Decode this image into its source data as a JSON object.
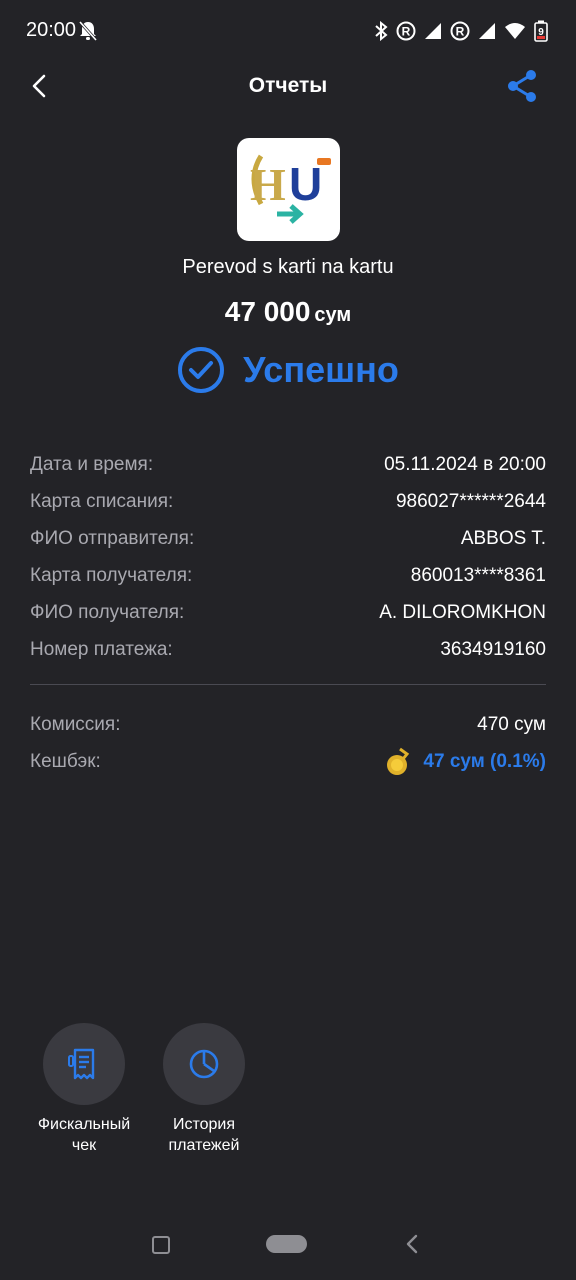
{
  "status_bar": {
    "time": "20:00",
    "battery_level": "9",
    "icons": [
      "bell-off-icon",
      "bluetooth-icon",
      "roaming-icon",
      "signal-icon",
      "roaming-icon",
      "signal-icon",
      "wifi-icon",
      "battery-icon"
    ]
  },
  "header": {
    "title": "Отчеты",
    "back_icon": "chevron-left-icon",
    "share_icon": "share-icon"
  },
  "service": {
    "logo_text": "HU",
    "name": "Perevod s karti na kartu"
  },
  "amount": {
    "value": "47 000",
    "currency": "сум"
  },
  "status": {
    "label": "Успешно",
    "icon": "check-circle-icon",
    "color": "#2b7bea"
  },
  "details": [
    {
      "label": "Дата и время:",
      "value": "05.11.2024 в 20:00"
    },
    {
      "label": "Карта списания:",
      "value": "986027******2644"
    },
    {
      "label": "ФИО отправителя:",
      "value": "ABBOS T."
    },
    {
      "label": "Карта получателя:",
      "value": "860013****8361"
    },
    {
      "label": "ФИО получателя:",
      "value": "A. DILOROMKHON"
    },
    {
      "label": "Номер платежа:",
      "value": "3634919160"
    }
  ],
  "fees": {
    "commission_label": "Комиссия:",
    "commission_value": "470 сум",
    "cashback_label": "Кешбэк:",
    "cashback_value": "47 сум (0.1%)",
    "cashback_icon": "coin-icon"
  },
  "actions": [
    {
      "label_line1": "Фискальный",
      "label_line2": "чек",
      "icon": "receipt-icon"
    },
    {
      "label_line1": "История",
      "label_line2": "платежей",
      "icon": "pie-chart-icon"
    }
  ],
  "colors": {
    "background": "#232327",
    "accent": "#2b7bea",
    "muted_text": "#a9a9b0",
    "button_bg": "#3a3a40"
  }
}
